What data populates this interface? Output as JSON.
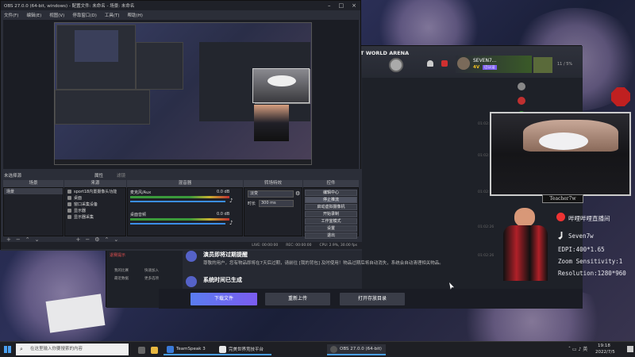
{
  "obs": {
    "title": "OBS 27.0.0 (64-bit, windows) - 配置文件: 未命名 - 场景: 未命名",
    "menu": [
      "文件(F)",
      "编辑(E)",
      "视图(V)",
      "停靠窗口(D)",
      "工具(T)",
      "帮助(H)"
    ],
    "no_source_label": "未选择源",
    "properties_label": "属性",
    "filters_label": "滤镜",
    "docks": {
      "scenes": "场景",
      "sources": "来源",
      "mixer": "混音器",
      "transitions": "转场特效",
      "controls": "控件"
    },
    "scenes": [
      "场景"
    ],
    "sources": [
      "sport18内置摄像头功能",
      "桌面",
      "窗口采集设备",
      "显示器",
      "显示器采集"
    ],
    "mixer": [
      {
        "name": "麦克风/Aux",
        "level": "0.0 dB"
      },
      {
        "name": "桌面音频",
        "level": "0.0 dB"
      }
    ],
    "transition": {
      "selected": "淡变",
      "duration_label": "时长",
      "duration": "300 ms"
    },
    "controls": [
      "编辑中心",
      "停止推流",
      "启动虚拟摄像机",
      "开始录制",
      "工作室模式",
      "设置",
      "退出"
    ],
    "status": {
      "live": "LIVE: 00:00:00",
      "rec": "REC: 00:00:00",
      "cpu": "CPU: 2.9%, 30.00 fps"
    }
  },
  "game": {
    "header": "T WORLD ARENA",
    "username": "SEVEN7...",
    "level": "4V",
    "badge": "已认证",
    "counter": "11 / 5%",
    "sidebar": {
      "items": [
        "我的比赛",
        "快速加入",
        "最近数据",
        "更多选项"
      ],
      "highlight": "退赛提示"
    },
    "timestamps": [
      "01:02:26",
      "01:02:26",
      "01:02:26",
      "01:02:26",
      "01:02:26"
    ],
    "notices": [
      {
        "title": "演员即将过期提醒",
        "desc": "尊敬的用户，您有物品即将在7天后过期，请前往 [我的背包] 及时使用！物品过期后将自动消失，系统会自动清理相关物品。"
      },
      {
        "title": "演员即将过期提醒",
        "desc": ""
      },
      {
        "title": "系统时间已生成",
        "desc": ""
      }
    ],
    "buttons": [
      "下载文件",
      "重新上传",
      "打开存放目录"
    ]
  },
  "cam_label": "Teacher7w",
  "overlay": {
    "bilibili": "哔哩哔哩直播间",
    "douyin": "Seven7w",
    "dpi": "EDPI:400*1.65",
    "zoom": "Zoom Sensitivity:1",
    "resolution": "Resolution:1280*960"
  },
  "taskbar": {
    "search_placeholder": "在这里输入你要搜索的内容",
    "apps": [
      "TeamSpeak 3",
      "完美世界竞技平台",
      "OBS 27.0.0 (64-bit)"
    ],
    "time": "19:18",
    "date": "2022/7/5"
  },
  "colors": {
    "accent_blue": "#5562c8",
    "accent_purple": "#7b5cf0",
    "obs_bg": "#2b2e38"
  }
}
